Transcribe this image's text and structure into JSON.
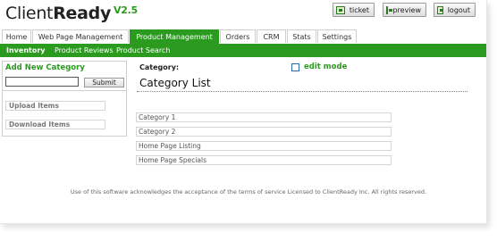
{
  "header": {
    "logo_text": "Client",
    "logo_bold": "Ready",
    "version": "V2.5",
    "buttons": {
      "ticket": "ticket",
      "preview": "preview",
      "logout": "logout"
    }
  },
  "tabs": [
    {
      "label": "Home"
    },
    {
      "label": "Web Page Management"
    },
    {
      "label": "Product Management",
      "active": true
    },
    {
      "label": "Orders"
    },
    {
      "label": "CRM"
    },
    {
      "label": "Stats"
    },
    {
      "label": "Settings"
    }
  ],
  "subnav": [
    {
      "label": "Inventory",
      "active": true
    },
    {
      "label": "Product Reviews"
    },
    {
      "label": "Product Search"
    }
  ],
  "sidebar": {
    "title": "Add New Category",
    "input_value": "",
    "submit_label": "Submit",
    "links": [
      "Upload Items",
      "Download Items"
    ]
  },
  "main": {
    "category_label": "Category:",
    "edit_mode_label": "edit mode",
    "list_title": "Category List",
    "categories": [
      "Category 1",
      "Category 2",
      "Home Page Listing",
      "Home Page Specials"
    ]
  },
  "footer": {
    "text": "Use of this software acknowledges the acceptance of the terms of service Licensed to ClientReady Inc. All rights reserved."
  },
  "colors": {
    "brand_green": "#2a9b1f"
  }
}
